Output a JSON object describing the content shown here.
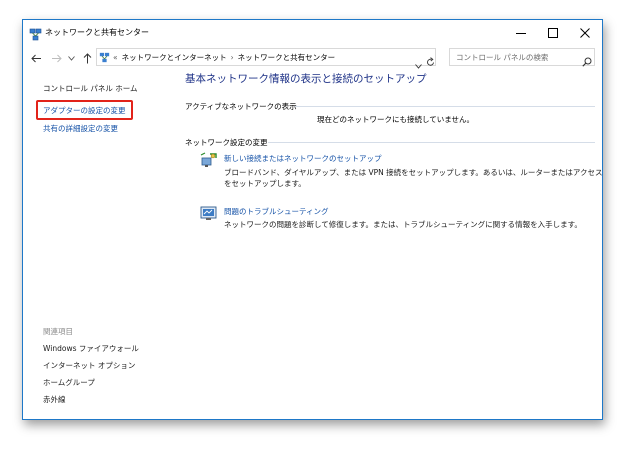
{
  "window": {
    "title": "ネットワークと共有センター",
    "controls": {
      "minimize": "—",
      "maximize": "☐",
      "close": "✕"
    }
  },
  "address": {
    "crumbs": [
      "«",
      "ネットワークとインターネット",
      "›",
      "ネットワークと共有センター"
    ],
    "search_placeholder": "コントロール パネルの検索"
  },
  "sidebar": {
    "home": "コントロール パネル ホーム",
    "items": [
      {
        "label": "アダプターの設定の変更"
      },
      {
        "label": "共有の詳細設定の変更"
      }
    ],
    "related_title": "関連項目",
    "related": [
      {
        "label": "Windows ファイアウォール"
      },
      {
        "label": "インターネット オプション"
      },
      {
        "label": "ホームグループ"
      },
      {
        "label": "赤外線"
      }
    ]
  },
  "main": {
    "title": "基本ネットワーク情報の表示と接続のセットアップ",
    "active_header": "アクティブなネットワークの表示",
    "active_status": "現在どのネットワークにも接続していません。",
    "settings_header": "ネットワーク設定の変更",
    "tasks": [
      {
        "link": "新しい接続またはネットワークのセットアップ",
        "desc_line1": "ブロードバンド、ダイヤルアップ、または VPN 接続をセットアップします。あるいは、ルーターまたはアクセス ポイント",
        "desc_line2": "をセットアップします。",
        "icon": "network-setup-icon"
      },
      {
        "link": "問題のトラブルシューティング",
        "desc_line1": "ネットワークの問題を診断して修復します。または、トラブルシューティングに関する情報を入手します。",
        "icon": "troubleshoot-icon"
      }
    ]
  },
  "colors": {
    "window_border": "#1e78c8",
    "link": "#1552a7",
    "title": "#1e3287",
    "highlight": "#e2231a"
  }
}
